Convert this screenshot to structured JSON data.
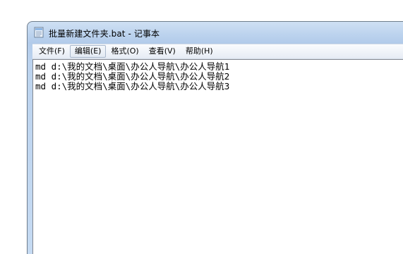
{
  "window": {
    "title": "批量新建文件夹.bat - 记事本",
    "icon": "notepad-icon"
  },
  "menu": {
    "items": [
      {
        "label": "文件(F)"
      },
      {
        "label": "编辑(E)",
        "active": true
      },
      {
        "label": "格式(O)"
      },
      {
        "label": "查看(V)"
      },
      {
        "label": "帮助(H)"
      }
    ]
  },
  "editor": {
    "lines": [
      "md d:\\我的文档\\桌面\\办公人导航\\办公人导航1",
      "md d:\\我的文档\\桌面\\办公人导航\\办公人导航2",
      "md d:\\我的文档\\桌面\\办公人导航\\办公人导航3"
    ]
  }
}
